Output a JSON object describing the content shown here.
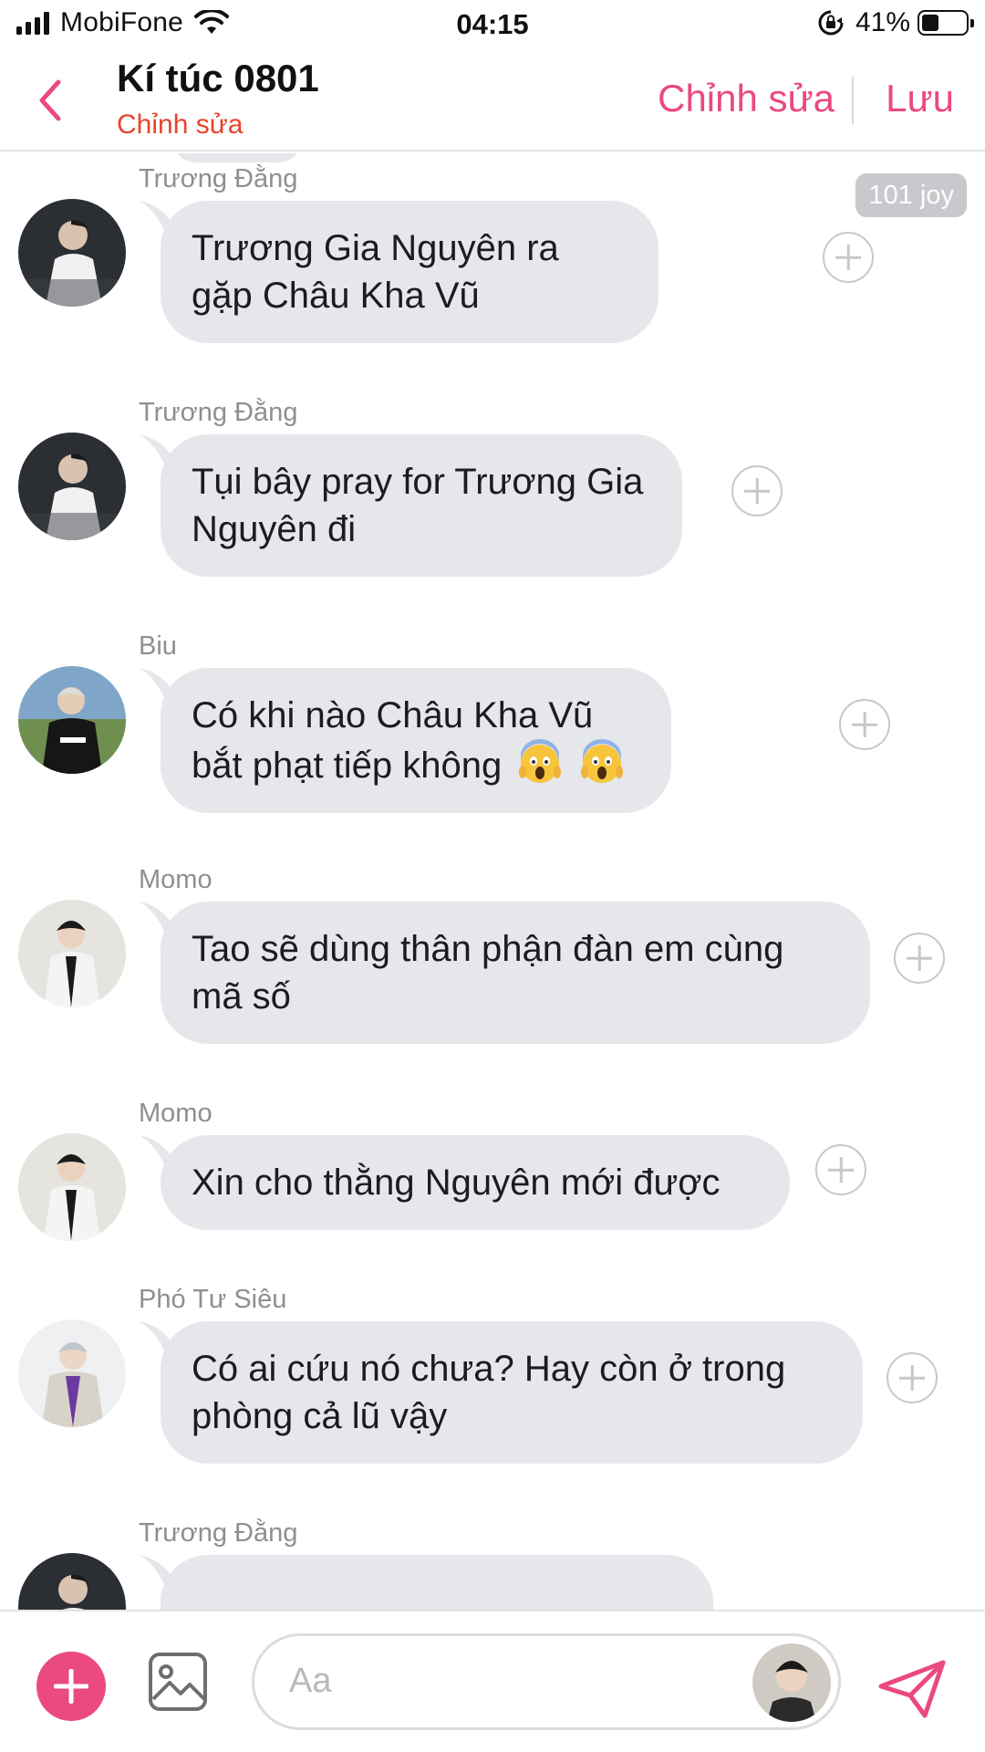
{
  "status_bar": {
    "carrier": "MobiFone",
    "time": "04:15",
    "battery": "41%",
    "battery_level": 0.41
  },
  "nav": {
    "title": "Kí túc 0801",
    "subtitle": "Chỉnh sửa",
    "edit_label": "Chỉnh sửa",
    "save_label": "Lưu"
  },
  "chat": {
    "joy_badge": "101 joy",
    "messages": [
      {
        "sender": "Trương Đằng",
        "text": "Trương Gia Nguyên ra gặp Châu Kha Vũ",
        "avatar": "truong-dang-avatar"
      },
      {
        "sender": "Trương Đằng",
        "text": "Tụi bây pray for Trương Gia Nguyên đi",
        "avatar": "truong-dang-avatar"
      },
      {
        "sender": "Biu",
        "text": "Có khi nào Châu Kha Vũ bắt phạt tiếp không",
        "avatar": "biu-avatar",
        "emoji": [
          "face-screaming-in-fear",
          "face-screaming-in-fear"
        ]
      },
      {
        "sender": "Momo",
        "text": "Tao sẽ dùng thân phận đàn em cùng mã số",
        "avatar": "momo-avatar"
      },
      {
        "sender": "Momo",
        "text": "Xin cho thằng Nguyên mới được",
        "avatar": "momo-avatar"
      },
      {
        "sender": "Phó Tư Siêu",
        "text": "Có ai cứu nó chưa? Hay còn ở trong phòng cả lũ vậy",
        "avatar": "pho-tu-sieu-avatar"
      },
      {
        "sender": "Trương Đằng",
        "text": "",
        "avatar": "truong-dang-avatar"
      }
    ]
  },
  "input": {
    "placeholder": "Aa"
  },
  "colors": {
    "accent": "#ea4a7d",
    "subtitle_red": "#e8432c",
    "bubble": "#e6e7eb",
    "sender_gray": "#8e8e93"
  }
}
